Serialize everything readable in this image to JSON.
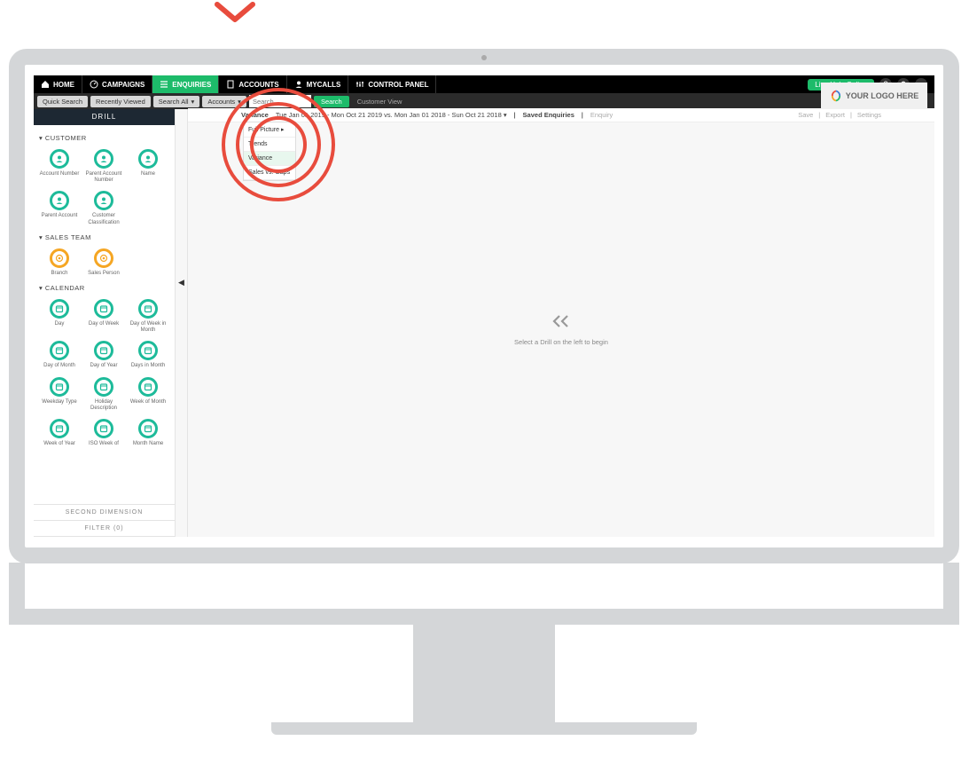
{
  "nav": {
    "items": [
      {
        "label": "HOME",
        "icon": "home"
      },
      {
        "label": "CAMPAIGNS",
        "icon": "speedometer"
      },
      {
        "label": "ENQUIRIES",
        "icon": "list",
        "active": true
      },
      {
        "label": "ACCOUNTS",
        "icon": "building"
      },
      {
        "label": "MYCALLS",
        "icon": "user"
      },
      {
        "label": "CONTROL PANEL",
        "icon": "sliders"
      }
    ],
    "live_help": "Live Help Online"
  },
  "subbar": {
    "quick_search": "Quick Search",
    "recently_viewed": "Recently Viewed",
    "search_all": "Search All",
    "accounts": "Accounts",
    "search_placeholder": "Search",
    "search_btn": "Search",
    "customer_view": "Customer View"
  },
  "logo_text": "YOUR LOGO HERE",
  "sidebar": {
    "header": "DRILL",
    "sections": [
      {
        "title": "CUSTOMER",
        "items": [
          {
            "label": "Account Number",
            "color": "teal",
            "glyph": "person"
          },
          {
            "label": "Parent Account Number",
            "color": "teal",
            "glyph": "person"
          },
          {
            "label": "Name",
            "color": "teal",
            "glyph": "person"
          },
          {
            "label": "Parent Account",
            "color": "teal",
            "glyph": "person"
          },
          {
            "label": "Customer Classification",
            "color": "teal",
            "glyph": "person"
          }
        ]
      },
      {
        "title": "SALES TEAM",
        "items": [
          {
            "label": "Branch",
            "color": "orange",
            "glyph": "target"
          },
          {
            "label": "Sales Person",
            "color": "orange",
            "glyph": "target"
          }
        ]
      },
      {
        "title": "CALENDAR",
        "items": [
          {
            "label": "Day",
            "color": "teal",
            "glyph": "calendar"
          },
          {
            "label": "Day of Week",
            "color": "teal",
            "glyph": "calendar"
          },
          {
            "label": "Day of Week in Month",
            "color": "teal",
            "glyph": "calendar"
          },
          {
            "label": "Day of Month",
            "color": "teal",
            "glyph": "calendar"
          },
          {
            "label": "Day of Year",
            "color": "teal",
            "glyph": "calendar"
          },
          {
            "label": "Days in Month",
            "color": "teal",
            "glyph": "calendar"
          },
          {
            "label": "Weekday Type",
            "color": "teal",
            "glyph": "calendar"
          },
          {
            "label": "Holiday Description",
            "color": "teal",
            "glyph": "calendar"
          },
          {
            "label": "Week of Month",
            "color": "teal",
            "glyph": "calendar"
          },
          {
            "label": "Week of Year",
            "color": "teal",
            "glyph": "calendar"
          },
          {
            "label": "ISO Week of",
            "color": "teal",
            "glyph": "calendar"
          },
          {
            "label": "Month Name",
            "color": "teal",
            "glyph": "calendar"
          }
        ]
      }
    ],
    "second_dimension": "SECOND DIMENSION",
    "filter": "FILTER (0)"
  },
  "main": {
    "enquiry_type": "Variance",
    "date_range": "Tue Jan 01 2019 - Mon Oct 21 2019 vs. Mon Jan 01 2018 - Sun Oct 21 2018 ▾",
    "saved_enquiries": "Saved Enquiries",
    "enquiry_label": "Enquiry",
    "save": "Save",
    "export": "Export",
    "settings": "Settings",
    "dropdown": [
      "Full Picture",
      "Trends",
      "Variance",
      "Sales vs. Gaps"
    ],
    "placeholder": "Select a Drill on the left to begin"
  }
}
